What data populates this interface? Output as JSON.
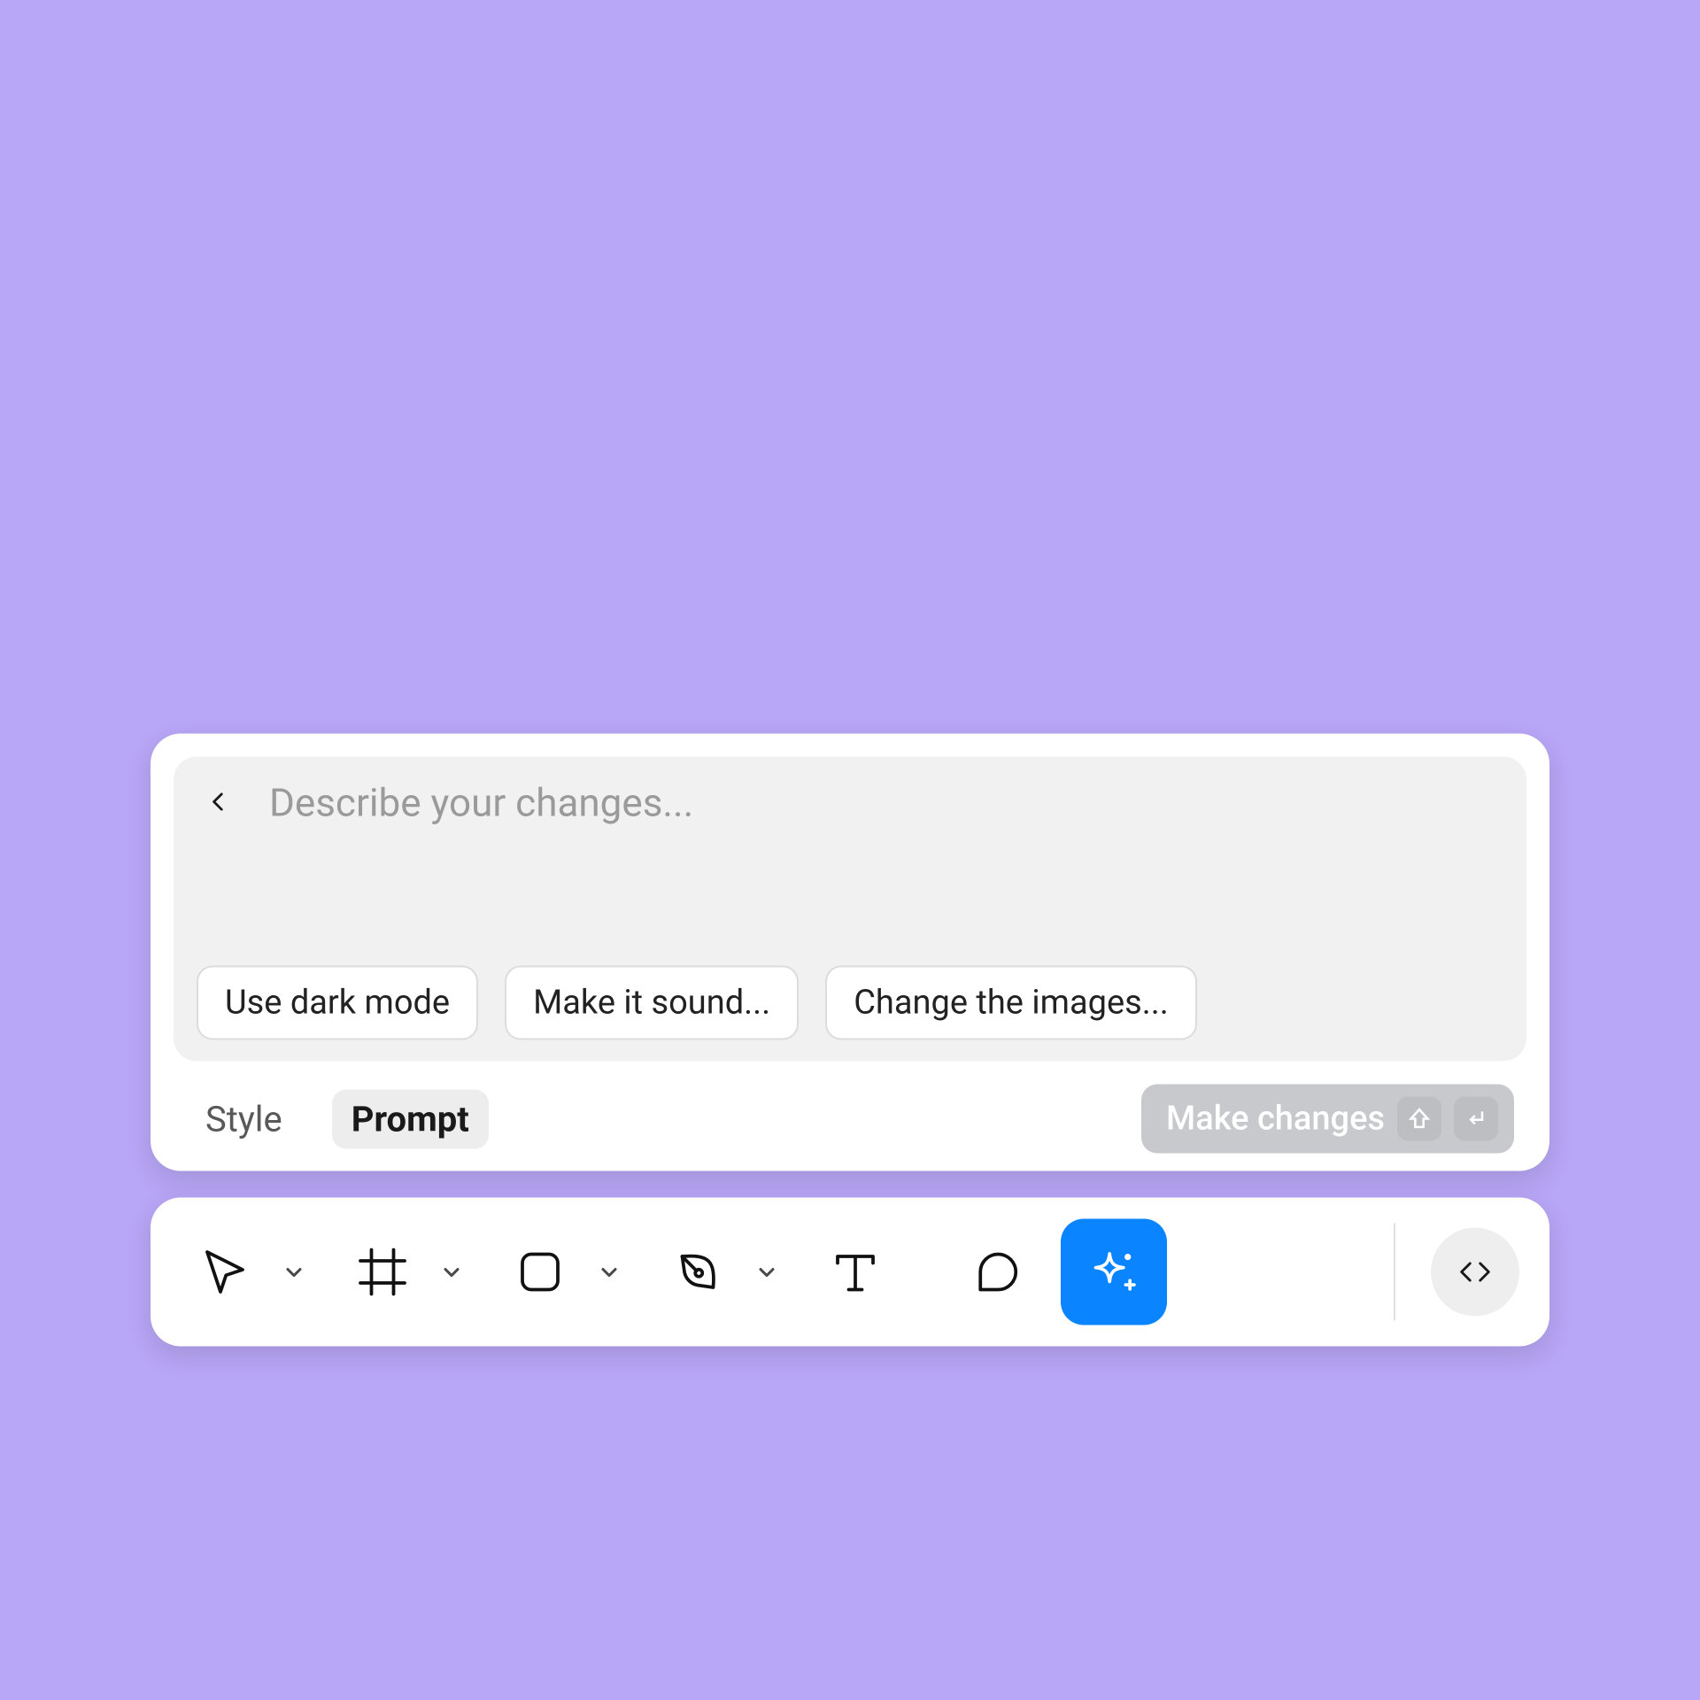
{
  "prompt": {
    "placeholder": "Describe your changes...",
    "value": "",
    "suggestions": {
      "dark": "Use dark mode",
      "sound": "Make it sound...",
      "images": "Change the images..."
    }
  },
  "tabs": {
    "style": "Style",
    "prompt": "Prompt"
  },
  "submit": {
    "label": "Make changes"
  },
  "tools": {
    "select": "select",
    "frame": "frame",
    "shape": "shape",
    "pen": "pen",
    "text": "text",
    "comment": "comment",
    "ai": "ai-sparkle",
    "code": "code"
  },
  "icons": {
    "back": "chevron-left-icon",
    "shift": "shift-icon",
    "enter": "enter-icon"
  },
  "colors": {
    "accent": "#0a84ff",
    "background": "#b8a6f6"
  }
}
